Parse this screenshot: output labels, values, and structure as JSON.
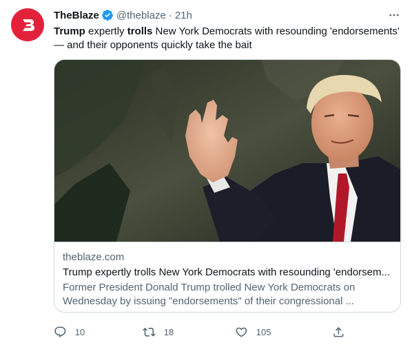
{
  "tweet": {
    "display_name": "TheBlaze",
    "handle": "@theblaze",
    "separator": "·",
    "time": "21h",
    "text": {
      "p1": "Trump",
      "p2": " expertly ",
      "p3": "trolls",
      "p4": " New York Democrats with resounding 'endorsements' — and their opponents quickly take the bait"
    },
    "verified": true,
    "avatar_color": "#e2223b"
  },
  "card": {
    "domain": "theblaze.com",
    "title": "Trump expertly trolls New York Democrats with resounding 'endorsem...",
    "description": "Former President Donald Trump trolled New York Democrats on Wednesday by issuing \"endorsements\" of their congressional ..."
  },
  "actions": {
    "reply": {
      "icon": "reply-icon",
      "count": "10"
    },
    "retweet": {
      "icon": "retweet-icon",
      "count": "18"
    },
    "like": {
      "icon": "heart-icon",
      "count": "105"
    },
    "share": {
      "icon": "share-icon"
    }
  },
  "colors": {
    "accent": "#1d9bf0",
    "text_primary": "#0f1419",
    "text_secondary": "#536471",
    "border": "#cfd9de"
  }
}
